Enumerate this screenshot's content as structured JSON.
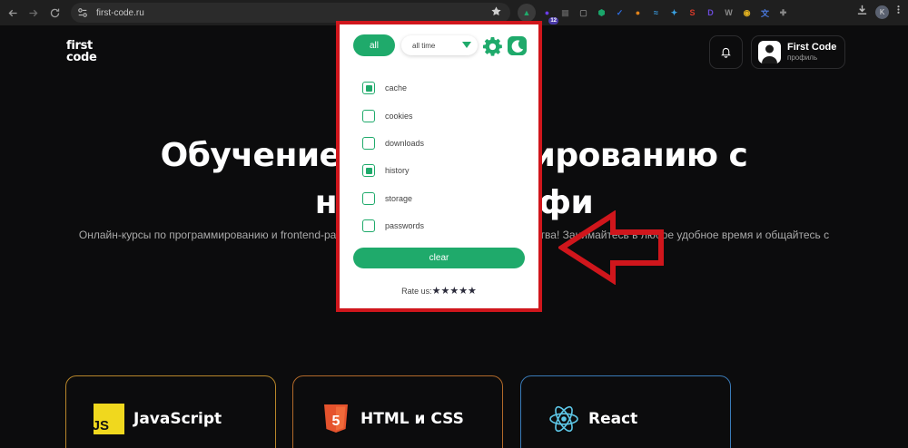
{
  "browser": {
    "url": "first-code.ru",
    "extension_badge": "12",
    "profile_initial": "K",
    "extensions": [
      {
        "name": "active-cleaner-icon",
        "color": "#1faa6b",
        "glyph": "▲"
      },
      {
        "name": "ext-purple-icon",
        "color": "#6a3de8",
        "glyph": "●"
      },
      {
        "name": "ext-calendar-icon",
        "color": "#555555",
        "glyph": "▦"
      },
      {
        "name": "ext-notes-icon",
        "color": "#7a7a7a",
        "glyph": "▢"
      },
      {
        "name": "ext-shield-icon",
        "color": "#1aa56a",
        "glyph": "⬢"
      },
      {
        "name": "ext-check-icon",
        "color": "#2d6cdf",
        "glyph": "✓"
      },
      {
        "name": "ext-orange-icon",
        "color": "#e0821a",
        "glyph": "●"
      },
      {
        "name": "ext-wave-icon",
        "color": "#3a9be0",
        "glyph": "≈"
      },
      {
        "name": "ext-bird-icon",
        "color": "#3aa0e0",
        "glyph": "✦"
      },
      {
        "name": "ext-s-icon",
        "color": "#d83a2a",
        "glyph": "S"
      },
      {
        "name": "ext-d-icon",
        "color": "#6a4ad8",
        "glyph": "D"
      },
      {
        "name": "ext-w-icon",
        "color": "#8a8a8a",
        "glyph": "W"
      },
      {
        "name": "ext-chrome-icon",
        "color": "#e0b020",
        "glyph": "◉"
      },
      {
        "name": "ext-translate-icon",
        "color": "#4a7ae0",
        "glyph": "文"
      },
      {
        "name": "ext-puzzle-icon",
        "color": "#8a8a8a",
        "glyph": "✚"
      }
    ]
  },
  "site": {
    "logo_line1": "first",
    "logo_line2": "code",
    "profile_name": "First Code",
    "profile_sub": "профиль",
    "hero_line1": "Обучение программированию с",
    "hero_line2": "нуля до профи",
    "hero_sub": "Онлайн-курсы по программированию и frontend-разработке с поддержкой до трудоустройства! Занимайтесь в любое удобное время и общайтесь с преподавателем.",
    "courses": [
      {
        "label": "JavaScript",
        "icon": "javascript-logo-icon",
        "badge": "JS"
      },
      {
        "label": "HTML и CSS",
        "icon": "html5-logo-icon",
        "badge": "5"
      },
      {
        "label": "React",
        "icon": "react-logo-icon",
        "badge": ""
      }
    ]
  },
  "popup": {
    "all_label": "all",
    "time_value": "all time",
    "options": [
      {
        "label": "cache",
        "checked": true
      },
      {
        "label": "cookies",
        "checked": false
      },
      {
        "label": "downloads",
        "checked": false
      },
      {
        "label": "history",
        "checked": true
      },
      {
        "label": "storage",
        "checked": false
      },
      {
        "label": "passwords",
        "checked": false
      }
    ],
    "clear_label": "clear",
    "rate_label": "Rate us:",
    "stars": "★★★★★",
    "accent": "#1faa6b",
    "highlight_border": "#d0161c"
  }
}
